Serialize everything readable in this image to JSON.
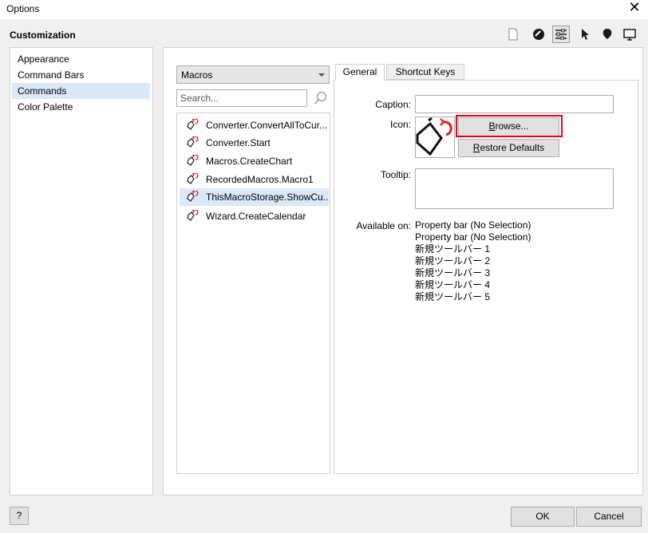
{
  "window": {
    "title": "Options",
    "close_glyph": "✕"
  },
  "section_title": "Customization",
  "toolbar_icons": [
    {
      "name": "page-icon",
      "selected": false
    },
    {
      "name": "color-disc-icon",
      "selected": false
    },
    {
      "name": "settings-sliders-icon",
      "selected": true
    },
    {
      "name": "pointer-icon",
      "selected": false
    },
    {
      "name": "balloon-icon",
      "selected": false
    },
    {
      "name": "monitor-icon",
      "selected": false
    }
  ],
  "nav": {
    "items": [
      {
        "label": "Appearance",
        "selected": false
      },
      {
        "label": "Command Bars",
        "selected": false
      },
      {
        "label": "Commands",
        "selected": true
      },
      {
        "label": "Color Palette",
        "selected": false
      }
    ]
  },
  "category_combo": {
    "value": "Macros"
  },
  "search": {
    "placeholder": "Search...",
    "value": ""
  },
  "commands": [
    {
      "label": "Converter.ConvertAllToCur...",
      "selected": false
    },
    {
      "label": "Converter.Start",
      "selected": false
    },
    {
      "label": "Macros.CreateChart",
      "selected": false
    },
    {
      "label": "RecordedMacros.Macro1",
      "selected": false
    },
    {
      "label": "ThisMacroStorage.ShowCu...",
      "selected": true
    },
    {
      "label": "Wizard.CreateCalendar",
      "selected": false
    }
  ],
  "tabs": [
    {
      "label": "General",
      "active": true
    },
    {
      "label": "Shortcut Keys",
      "active": false
    }
  ],
  "general": {
    "caption_label": "Caption:",
    "caption_value": "",
    "icon_label": "Icon:",
    "browse_button": {
      "pre": "B",
      "rest": "rowse..."
    },
    "restore_button": {
      "pre": "R",
      "rest": "estore Defaults"
    },
    "tooltip_label": "Tooltip:",
    "tooltip_value": "",
    "available_label": "Available on:",
    "available_on": [
      "Property bar (No Selection)",
      "Property bar (No Selection)",
      "新規ツールバー 1",
      "新規ツールバー 2",
      "新規ツールバー 3",
      "新規ツールバー 4",
      "新規ツールバー 5"
    ]
  },
  "footer": {
    "help": "?",
    "ok": "OK",
    "cancel": "Cancel"
  },
  "colors": {
    "selection": "#dbe8f7",
    "highlight": "#e8001c",
    "accent_red": "#e02020"
  }
}
